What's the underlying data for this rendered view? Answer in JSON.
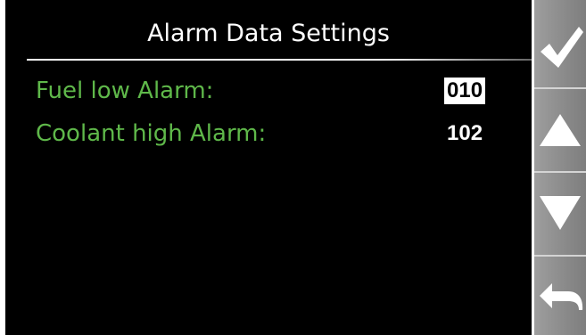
{
  "screen": {
    "title": "Alarm Data Settings",
    "rows": [
      {
        "label": "Fuel low Alarm:",
        "value": "010",
        "selected": true
      },
      {
        "label": "Coolant high Alarm:",
        "value": "102",
        "selected": false
      }
    ]
  },
  "sidebar": {
    "buttons": [
      {
        "icon": "check-icon"
      },
      {
        "icon": "arrow-up-icon"
      },
      {
        "icon": "arrow-down-icon"
      },
      {
        "icon": "back-arrow-icon"
      }
    ]
  },
  "colors": {
    "background": "#000000",
    "label": "#5fb84a",
    "title": "#ffffff",
    "sidebar": "#8f8f8f"
  }
}
